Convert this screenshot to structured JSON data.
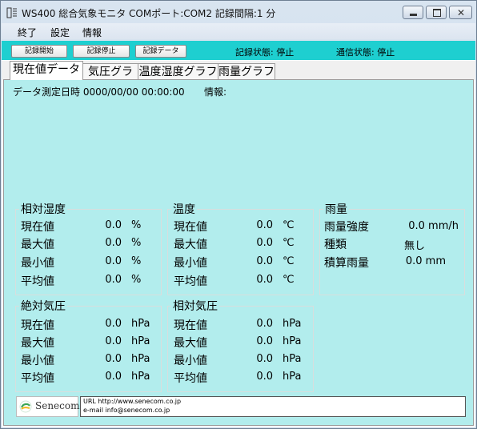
{
  "window": {
    "title": "WS400 総合気象モニタ COMポート:COM2 記録間隔:1 分",
    "app_icon": "app-icon"
  },
  "menu": [
    "終了",
    "設定",
    "情報"
  ],
  "toolbar": {
    "start_label": "記録開始",
    "stop_label": "記録停止",
    "data_label": "記録データ",
    "record_status": "記録状態: 停止",
    "comm_status": "通信状態: 停止"
  },
  "tabs": [
    "現在値データ",
    "気圧グラフ",
    "温度湿度グラフ",
    "雨量グラフ"
  ],
  "measure": {
    "datetime_label": "データ測定日時 0000/00/00 00:00:00",
    "info_label": "情報:"
  },
  "humidity": {
    "title": "相対湿度",
    "rows": [
      {
        "label": "現在値",
        "value": "0.0",
        "unit": "%"
      },
      {
        "label": "最大値",
        "value": "0.0",
        "unit": "%"
      },
      {
        "label": "最小値",
        "value": "0.0",
        "unit": "%"
      },
      {
        "label": "平均値",
        "value": "0.0",
        "unit": "%"
      }
    ]
  },
  "temperature": {
    "title": "温度",
    "rows": [
      {
        "label": "現在値",
        "value": "0.0",
        "unit": "℃"
      },
      {
        "label": "最大値",
        "value": "0.0",
        "unit": "℃"
      },
      {
        "label": "最小値",
        "value": "0.0",
        "unit": "℃"
      },
      {
        "label": "平均値",
        "value": "0.0",
        "unit": "℃"
      }
    ]
  },
  "rain": {
    "title": "雨量",
    "rows": [
      {
        "label": "雨量強度",
        "value": "0.0 mm/h"
      },
      {
        "label": "種類",
        "value": "無し"
      },
      {
        "label": "積算雨量",
        "value": "0.0 mm"
      }
    ]
  },
  "abs_pressure": {
    "title": "絶対気圧",
    "rows": [
      {
        "label": "現在値",
        "value": "0.0",
        "unit": "hPa"
      },
      {
        "label": "最大値",
        "value": "0.0",
        "unit": "hPa"
      },
      {
        "label": "最小値",
        "value": "0.0",
        "unit": "hPa"
      },
      {
        "label": "平均値",
        "value": "0.0",
        "unit": "hPa"
      }
    ]
  },
  "rel_pressure": {
    "title": "相対気圧",
    "rows": [
      {
        "label": "現在値",
        "value": "0.0",
        "unit": "hPa"
      },
      {
        "label": "最大値",
        "value": "0.0",
        "unit": "hPa"
      },
      {
        "label": "最小値",
        "value": "0.0",
        "unit": "hPa"
      },
      {
        "label": "平均値",
        "value": "0.0",
        "unit": "hPa"
      }
    ]
  },
  "footer": {
    "logo_text": "Senecom",
    "url_line": "URL http://www.senecom.co.jp",
    "email_line": "e-mail  info@senecom.co.jp"
  },
  "colors": {
    "toolbar": "#1ecfd0",
    "panel": "#b2eded"
  }
}
